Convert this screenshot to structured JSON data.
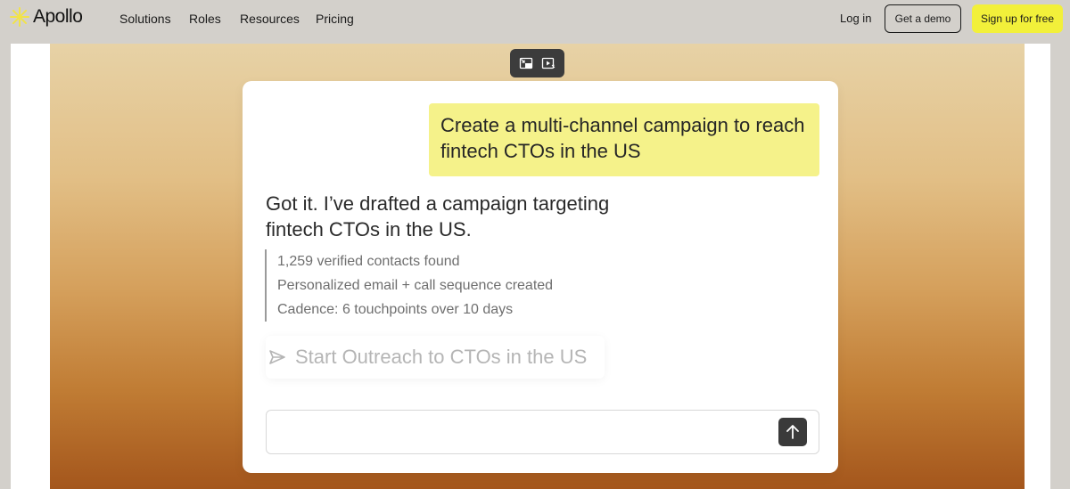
{
  "nav": {
    "brand": "Apollo",
    "links": [
      "Solutions",
      "Roles",
      "Resources",
      "Pricing"
    ],
    "login": "Log in",
    "demo": "Get a demo",
    "signup": "Sign up for free"
  },
  "chat": {
    "user_message": "Create a multi-channel campaign to reach fintech CTOs in the US",
    "reply": "Got it. I’ve drafted a campaign targeting fintech CTOs in the US.",
    "details": [
      "1,259 verified contacts found",
      "Personalized email + call sequence created",
      "Cadence: 6 touchpoints over 10 days"
    ],
    "suggestion": "Start Outreach to CTOs in the US",
    "input_value": ""
  },
  "colors": {
    "brand_yellow": "#f2f03a",
    "bubble_yellow": "#f5f28a",
    "nav_bg": "#d3d0cb"
  },
  "icons": [
    "apollo-logo-icon",
    "minimize-video-icon",
    "play-video-icon",
    "send-icon",
    "arrow-up-icon"
  ]
}
